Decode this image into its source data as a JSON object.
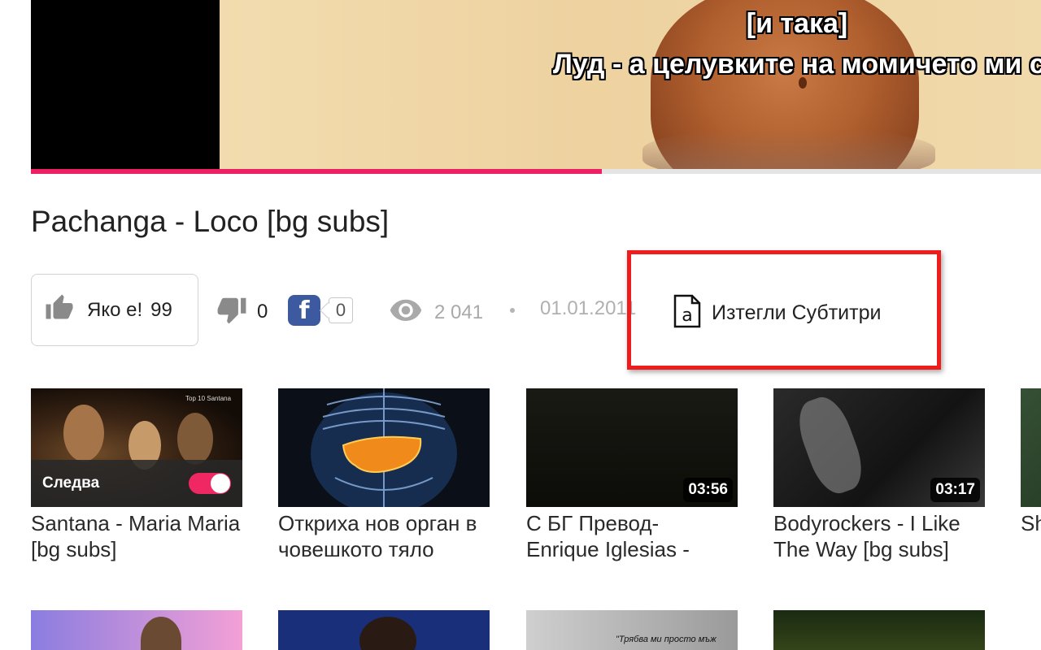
{
  "player": {
    "subtitle_line1": "[и така]",
    "subtitle_line2": "Луд - а целувките на момичето ми са с вкус",
    "progress": 0.565
  },
  "video": {
    "title": "Pachanga - Loco [bg subs]"
  },
  "actions": {
    "like_label": "Яко е!",
    "like_count": "99",
    "dislike_count": "0",
    "facebook_count": "0",
    "views": "2 041",
    "date": "01.01.2011",
    "download_subs_label": "Изтегли Субтитри"
  },
  "recommended": [
    {
      "title": "Santana - Maria Maria [bg subs]",
      "next_label": "Следва",
      "autoplay": true,
      "thumb_text": "Top 10 Santana"
    },
    {
      "title": "Откриха нов орган в човешкото тяло",
      "duration": ""
    },
    {
      "title": "С БГ Превод- Enrique Iglesias -",
      "duration": "03:56"
    },
    {
      "title": "Bodyrockers - I Like The Way [bg subs]",
      "duration": "03:17"
    },
    {
      "title": "Sh [bg",
      "duration": ""
    }
  ],
  "recommended_row2": [
    {
      "thumb_text": ""
    },
    {
      "thumb_text": ""
    },
    {
      "thumb_text": "\"Трябва ми просто мъж"
    },
    {
      "thumb_text": ""
    }
  ],
  "colors": {
    "accent": "#ef1f66",
    "highlight": "#ee1c1c",
    "facebook": "#3d5aa0"
  }
}
